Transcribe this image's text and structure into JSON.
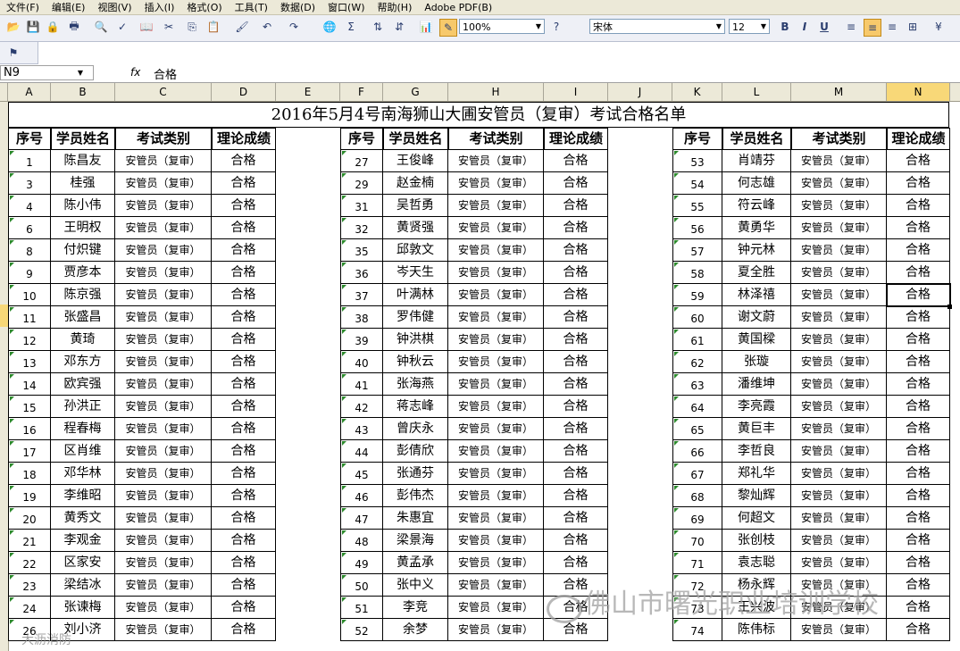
{
  "menu": [
    "文件(F)",
    "编辑(E)",
    "视图(V)",
    "插入(I)",
    "格式(O)",
    "工具(T)",
    "数据(D)",
    "窗口(W)",
    "帮助(H)",
    "Adobe PDF(B)"
  ],
  "toolbar": {
    "zoom": "100%",
    "font": "宋体",
    "size": "12"
  },
  "formula": {
    "namebox": "N9",
    "fx": "fx",
    "value": "合格"
  },
  "columns": [
    "A",
    "B",
    "C",
    "D",
    "E",
    "F",
    "G",
    "H",
    "I",
    "J",
    "K",
    "L",
    "M",
    "N"
  ],
  "title": "2016年5月4号南海狮山大圃安管员（复审）考试合格名单",
  "headers": {
    "seq": "序号",
    "name": "学员姓名",
    "category": "考试类别",
    "score": "理论成绩"
  },
  "category": "安管员（复审）",
  "result": "合格",
  "blocks": [
    {
      "nums": [
        "1",
        "3",
        "4",
        "6",
        "8",
        "9",
        "10",
        "11",
        "12",
        "13",
        "14",
        "15",
        "16",
        "17",
        "18",
        "19",
        "20",
        "21",
        "22",
        "23",
        "24",
        "26"
      ],
      "names": [
        "陈昌友",
        "桂强",
        "陈小伟",
        "王明权",
        "付炽键",
        "贾彦本",
        "陈京强",
        "张盛昌",
        "黄琦",
        "邓东方",
        "欧宾强",
        "孙洪正",
        "程春梅",
        "区肖维",
        "邓华林",
        "李维昭",
        "黄秀文",
        "李观金",
        "区家安",
        "梁结冰",
        "张谏梅",
        "刘小济"
      ]
    },
    {
      "nums": [
        "27",
        "29",
        "31",
        "32",
        "35",
        "36",
        "37",
        "38",
        "39",
        "40",
        "41",
        "42",
        "43",
        "44",
        "45",
        "46",
        "47",
        "48",
        "49",
        "50",
        "51",
        "52"
      ],
      "names": [
        "王俊峰",
        "赵金楠",
        "吴哲勇",
        "黄贤强",
        "邱敦文",
        "岑天生",
        "叶满林",
        "罗伟健",
        "钟洪棋",
        "钟秋云",
        "张海燕",
        "蒋志峰",
        "曾庆永",
        "彭倩欣",
        "张通芬",
        "彭伟杰",
        "朱惠宜",
        "梁景海",
        "黄孟承",
        "张中义",
        "李竞",
        "余梦"
      ]
    },
    {
      "nums": [
        "53",
        "54",
        "55",
        "56",
        "57",
        "58",
        "59",
        "60",
        "61",
        "62",
        "63",
        "64",
        "65",
        "66",
        "67",
        "68",
        "69",
        "70",
        "71",
        "72",
        "73",
        "74"
      ],
      "names": [
        "肖靖芬",
        "何志雄",
        "符云峰",
        "黄勇华",
        "钟元林",
        "夏全胜",
        "林泽禧",
        "谢文蔚",
        "黄国樑",
        "张璇",
        "潘维坤",
        "李亮霞",
        "黄巨丰",
        "李哲良",
        "郑礼华",
        "黎灿辉",
        "何超文",
        "张创枝",
        "袁志聪",
        "杨永辉",
        "王兴波",
        "陈伟标"
      ]
    }
  ],
  "watermark": "佛山市曙光职业培训学校",
  "watermark_small": "大沥消防"
}
